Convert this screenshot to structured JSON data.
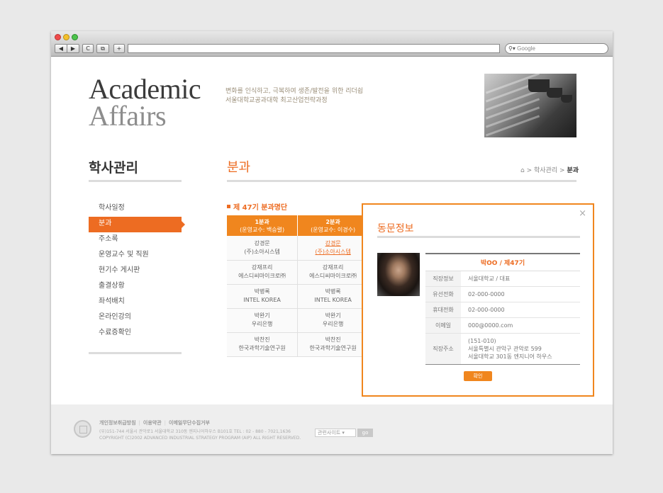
{
  "browser": {
    "nav_back": "◀",
    "nav_forward": "▶",
    "reload": "C",
    "bookmark": "⧉",
    "new_tab": "+",
    "search_placeholder": "Google"
  },
  "header": {
    "logo_line1": "Academic",
    "logo_line2": "Affairs",
    "tagline_line1": "변화를 인식하고, 극복하여 생존/발전을 위한 리더쉽",
    "tagline_line2": "서울대학교공과대학 최고산업전략과정"
  },
  "sidebar": {
    "title": "학사관리",
    "items": [
      {
        "label": "학사일정"
      },
      {
        "label": "분과"
      },
      {
        "label": "주소록"
      },
      {
        "label": "운영교수 및 직원"
      },
      {
        "label": "현기수 게시판"
      },
      {
        "label": "출결상황"
      },
      {
        "label": "좌석배치"
      },
      {
        "label": "온라인강의"
      },
      {
        "label": "수료증확인"
      }
    ]
  },
  "main": {
    "title": "분과",
    "breadcrumb": {
      "home_icon": "⌂",
      "sep": ">",
      "parent": "학사관리",
      "current": "분과"
    },
    "list_title": "제 47기 분과명단",
    "columns": [
      {
        "name": "1분과",
        "sub": "(운영교수: 백승렬)"
      },
      {
        "name": "2분과",
        "sub": "(운영교수: 이경수)"
      }
    ],
    "rows": [
      [
        {
          "name": "강경문",
          "org": "(주)소아시스템"
        },
        {
          "name": "강경문",
          "org": "(주)소아시스템"
        }
      ],
      [
        {
          "name": "강재프리",
          "org": "에스디씨마이크로㈜"
        },
        {
          "name": "강재프리",
          "org": "에스디씨마이크로㈜"
        }
      ],
      [
        {
          "name": "박병록",
          "org": "INTEL KOREA"
        },
        {
          "name": "박병록",
          "org": "INTEL KOREA"
        }
      ],
      [
        {
          "name": "박완기",
          "org": "우리은행"
        },
        {
          "name": "박완기",
          "org": "우리은행"
        }
      ],
      [
        {
          "name": "박찬진",
          "org": "한국과학기술연구원"
        },
        {
          "name": "박찬진",
          "org": "한국과학기술연구원"
        }
      ]
    ]
  },
  "popup": {
    "title": "동문정보",
    "close": "×",
    "name": "박OO / 제47기",
    "fields": [
      {
        "label": "직장정보",
        "value": "서울대학교 / 대표"
      },
      {
        "label": "유선전화",
        "value": "02-000-0000"
      },
      {
        "label": "휴대전화",
        "value": "02-000-0000"
      },
      {
        "label": "이메일",
        "value": "000@0000.com"
      }
    ],
    "address_label": "직장주소",
    "address_line1": "(151-010)",
    "address_line2": "서울특별시 관악구 관악로 599",
    "address_line3": "서울대학교 301동 엔지니어 하우스",
    "confirm": "확인"
  },
  "footer": {
    "link1": "개인정보취급방침",
    "link2": "이용약관",
    "link3": "이메일무단수집거부",
    "sep": "|",
    "address": "(우)151-744 서울시 관악로1 서울대학교 310동 엔지니어하우스 B101호     TEL : 02 - 880 - 7021,1636",
    "copyright": "COPYRIGHT (C)2002 ADVANCED INDUSTRIAL STRATEGY PROGRAM (AIP) ALL RIGHT RESERVED.",
    "related_sites": "관련사이트 ▾",
    "go": "go"
  }
}
